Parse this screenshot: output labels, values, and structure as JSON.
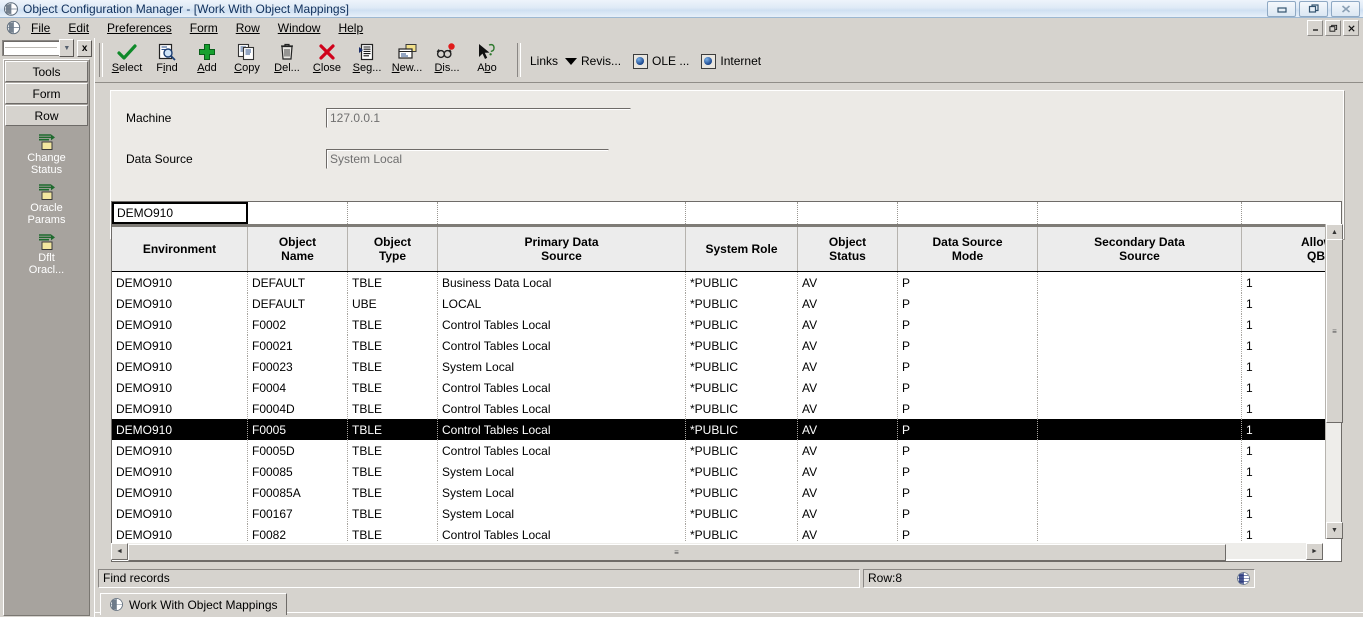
{
  "window": {
    "title": "Object Configuration Manager - [Work With Object Mappings]",
    "app_icon": "globe-icon",
    "controls": {
      "minimize": "–",
      "restore": "❐",
      "close": "✕"
    },
    "mdi_controls": {
      "minimize": "–",
      "restore": "❐",
      "close": "✕"
    }
  },
  "menubar": {
    "icon": "globe-icon",
    "items": [
      {
        "label": "File",
        "accel": "F"
      },
      {
        "label": "Edit",
        "accel": "E"
      },
      {
        "label": "Preferences",
        "accel": "P"
      },
      {
        "label": "Form",
        "accel": "F"
      },
      {
        "label": "Row",
        "accel": "R"
      },
      {
        "label": "Window",
        "accel": "W"
      },
      {
        "label": "Help",
        "accel": "H"
      }
    ]
  },
  "exitbar": {
    "combo_value": "",
    "close_label": "x",
    "buttons": [
      {
        "label": "Tools"
      },
      {
        "label": "Form"
      },
      {
        "label": "Row"
      }
    ],
    "items": [
      {
        "label": "Change\nStatus",
        "line1": "Change",
        "line2": "Status",
        "icon": "form-doc-icon"
      },
      {
        "label": "Oracle\nParams",
        "line1": "Oracle",
        "line2": "Params",
        "icon": "form-doc-icon"
      },
      {
        "label": "Dflt\nOracl...",
        "line1": "Dflt",
        "line2": "Oracl...",
        "icon": "form-doc-icon"
      }
    ]
  },
  "toolbar": {
    "buttons": [
      {
        "label": "Select",
        "accel": "S",
        "rest": "elect",
        "icon": "checkmark-icon"
      },
      {
        "label": "Find",
        "accel": "F",
        "rest": "ind",
        "icon": "magnifier-icon"
      },
      {
        "label": "Add",
        "accel": "A",
        "rest": "dd",
        "icon": "plus-icon"
      },
      {
        "label": "Copy",
        "accel": "C",
        "rest": "opy",
        "icon": "copy-icon"
      },
      {
        "label": "Del...",
        "accel": "D",
        "rest": "el...",
        "icon": "trash-icon"
      },
      {
        "label": "Close",
        "accel": "C",
        "rest": "lose",
        "icon": "close-x-icon"
      },
      {
        "label": "Seg...",
        "accel": "S",
        "rest": "eg...",
        "icon": "sequence-icon"
      },
      {
        "label": "New...",
        "accel": "N",
        "rest": "ew...",
        "icon": "new-window-icon"
      },
      {
        "label": "Dis...",
        "accel": "D",
        "rest": "is...",
        "icon": "display-icon"
      },
      {
        "label": "Abo",
        "accel": "b",
        "rest": "o",
        "icon": "about-cursor-icon"
      }
    ],
    "links_label": "Links",
    "links": [
      {
        "label": "Revis...",
        "icon": "chevron-down-icon"
      },
      {
        "label": "OLE ...",
        "icon": "ole-icon"
      },
      {
        "label": "Internet",
        "icon": "ole-icon"
      }
    ]
  },
  "form": {
    "fields": [
      {
        "label": "Machine",
        "value": "127.0.0.1"
      },
      {
        "label": "Data Source",
        "value": "System Local"
      }
    ]
  },
  "grid": {
    "qbe": [
      "DEMO910",
      "",
      "",
      "",
      "",
      "",
      "",
      "",
      ""
    ],
    "columns": [
      {
        "label": "Environment",
        "line1": "Environment",
        "line2": ""
      },
      {
        "label": "Object Name",
        "line1": "Object",
        "line2": "Name"
      },
      {
        "label": "Object Type",
        "line1": "Object",
        "line2": "Type"
      },
      {
        "label": "Primary Data Source",
        "line1": "Primary Data",
        "line2": "Source"
      },
      {
        "label": "System Role",
        "line1": "System Role",
        "line2": ""
      },
      {
        "label": "Object Status",
        "line1": "Object",
        "line2": "Status"
      },
      {
        "label": "Data Source Mode",
        "line1": "Data Source",
        "line2": "Mode"
      },
      {
        "label": "Secondary Data Source",
        "line1": "Secondary Data",
        "line2": "Source"
      },
      {
        "label": "Allow QBE",
        "line1": "Allow",
        "line2": "QBE"
      }
    ],
    "rows": [
      {
        "cells": [
          "DEMO910",
          "DEFAULT",
          "TBLE",
          "Business Data Local",
          "*PUBLIC",
          "AV",
          "P",
          "",
          "1"
        ],
        "selected": false
      },
      {
        "cells": [
          "DEMO910",
          "DEFAULT",
          "UBE",
          "LOCAL",
          "*PUBLIC",
          "AV",
          "P",
          "",
          "1"
        ],
        "selected": false
      },
      {
        "cells": [
          "DEMO910",
          "F0002",
          "TBLE",
          "Control Tables Local",
          "*PUBLIC",
          "AV",
          "P",
          "",
          "1"
        ],
        "selected": false
      },
      {
        "cells": [
          "DEMO910",
          "F00021",
          "TBLE",
          "Control Tables Local",
          "*PUBLIC",
          "AV",
          "P",
          "",
          "1"
        ],
        "selected": false
      },
      {
        "cells": [
          "DEMO910",
          "F00023",
          "TBLE",
          "System Local",
          "*PUBLIC",
          "AV",
          "P",
          "",
          "1"
        ],
        "selected": false
      },
      {
        "cells": [
          "DEMO910",
          "F0004",
          "TBLE",
          "Control Tables Local",
          "*PUBLIC",
          "AV",
          "P",
          "",
          "1"
        ],
        "selected": false
      },
      {
        "cells": [
          "DEMO910",
          "F0004D",
          "TBLE",
          "Control Tables Local",
          "*PUBLIC",
          "AV",
          "P",
          "",
          "1"
        ],
        "selected": false
      },
      {
        "cells": [
          "DEMO910",
          "F0005",
          "TBLE",
          "Control Tables Local",
          "*PUBLIC",
          "AV",
          "P",
          "",
          "1"
        ],
        "selected": true
      },
      {
        "cells": [
          "DEMO910",
          "F0005D",
          "TBLE",
          "Control Tables Local",
          "*PUBLIC",
          "AV",
          "P",
          "",
          "1"
        ],
        "selected": false
      },
      {
        "cells": [
          "DEMO910",
          "F00085",
          "TBLE",
          "System Local",
          "*PUBLIC",
          "AV",
          "P",
          "",
          "1"
        ],
        "selected": false
      },
      {
        "cells": [
          "DEMO910",
          "F00085A",
          "TBLE",
          "System Local",
          "*PUBLIC",
          "AV",
          "P",
          "",
          "1"
        ],
        "selected": false
      },
      {
        "cells": [
          "DEMO910",
          "F00167",
          "TBLE",
          "System Local",
          "*PUBLIC",
          "AV",
          "P",
          "",
          "1"
        ],
        "selected": false
      },
      {
        "cells": [
          "DEMO910",
          "F0082",
          "TBLE",
          "Control Tables Local",
          "*PUBLIC",
          "AV",
          "P",
          "",
          "1"
        ],
        "selected": false
      }
    ],
    "scroll": {
      "up_arrow": "▲",
      "down_arrow": "▼",
      "left_arrow": "◄",
      "right_arrow": "►",
      "grip": "≡"
    }
  },
  "statusbar": {
    "message": "Find records",
    "row_indicator": "Row:8",
    "globe_icon": "globe-icon"
  },
  "tabbar": {
    "tabs": [
      {
        "label": "Work With Object Mappings",
        "icon": "globe-icon",
        "active": true
      }
    ]
  }
}
